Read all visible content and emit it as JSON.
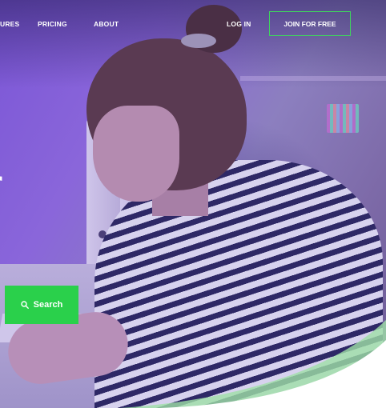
{
  "nav": {
    "features_label": "URES",
    "pricing_label": "PRICING",
    "about_label": "ABOUT",
    "login_label": "LOG IN",
    "join_label": "JOIN FOR FREE"
  },
  "hero": {
    "headline_fragment": "r",
    "search_label": "Search"
  },
  "icons": {
    "search": "search-icon"
  },
  "colors": {
    "accent_green": "#2ad04b",
    "overlay_purple": "#7b56d6"
  }
}
